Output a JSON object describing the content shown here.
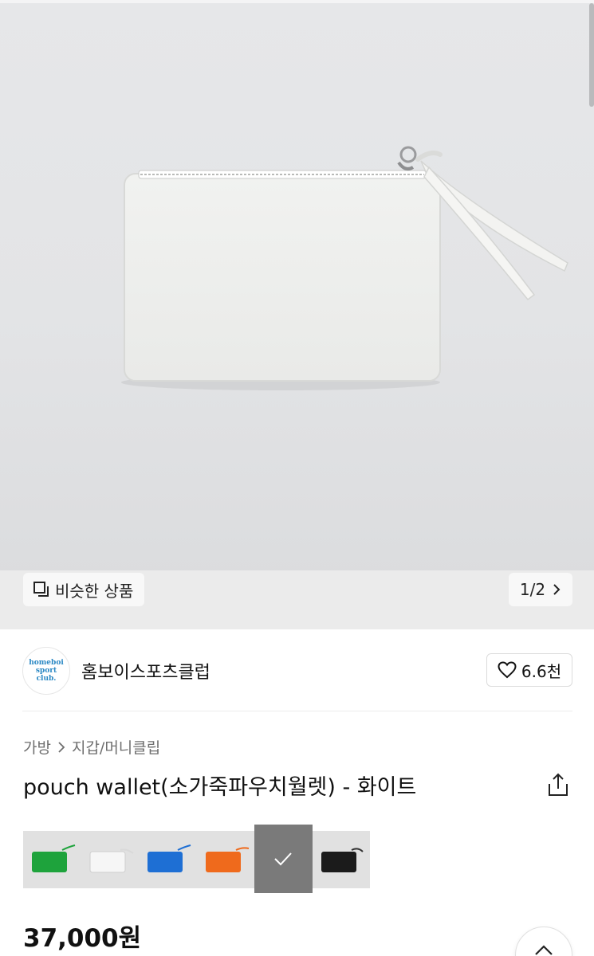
{
  "gallery": {
    "similar_label": "비슷한 상품",
    "page_indicator": "1/2"
  },
  "brand": {
    "logo_lines": [
      "homeboi",
      "sport",
      "club."
    ],
    "name": "홈보이스포츠클럽",
    "likes": "6.6천"
  },
  "breadcrumb": [
    "가방",
    "지갑/머니클립"
  ],
  "product": {
    "title": "pouch wallet(소가죽파우치월렛) - 화이트",
    "price": "37,000원"
  },
  "swatches": [
    {
      "color": "green",
      "hex": "#1ea33c",
      "selected": false
    },
    {
      "color": "white",
      "hex": "#f2f2f2",
      "selected": false
    },
    {
      "color": "blue",
      "hex": "#1e6fd4",
      "selected": false
    },
    {
      "color": "orange",
      "hex": "#ef6a1c",
      "selected": false
    },
    {
      "color": "white",
      "hex": "#ececec",
      "selected": true
    },
    {
      "color": "black",
      "hex": "#1b1b1b",
      "selected": false
    }
  ],
  "icons": {
    "similar": "stacked-squares-icon",
    "next": "chevron-right-icon",
    "like": "heart-icon",
    "share": "share-icon",
    "check": "check-icon",
    "scroll_top": "chevron-up-icon"
  },
  "colors": {
    "accent_logo": "#2a88c4",
    "text_primary": "#111111",
    "text_secondary": "#6e6e6e"
  }
}
